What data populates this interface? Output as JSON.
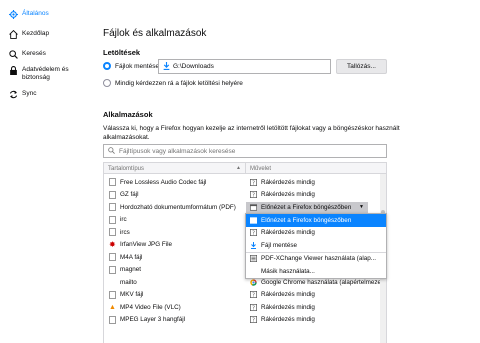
{
  "sidebar": {
    "items": [
      {
        "label": "Általános",
        "icon": "gear-icon",
        "active": true
      },
      {
        "label": "Kezdőlap",
        "icon": "home-icon",
        "active": false
      },
      {
        "label": "Keresés",
        "icon": "search-icon",
        "active": false
      },
      {
        "label_line1": "Adatvédelem és",
        "label_line2": "biztonság",
        "icon": "lock-icon",
        "active": false
      },
      {
        "label": "Sync",
        "icon": "sync-icon",
        "active": false
      }
    ]
  },
  "main": {
    "title": "Fájlok és alkalmazások",
    "downloads": {
      "heading": "Letöltések",
      "save_label": "Fájlok mentése",
      "save_path": "G:\\Downloads",
      "browse_button": "Tallózás...",
      "ask_label": "Mindig kérdezzen rá a fájlok letöltési helyére"
    },
    "apps": {
      "heading": "Alkalmazások",
      "description": "Válassza ki, hogy a Firefox hogyan kezelje az internetről letöltött fájlokat vagy a böngészéskor használt alkalmazásokat.",
      "search_placeholder": "Fájltípusok vagy alkalmazások keresése",
      "columns": [
        "Tartalomtípus",
        "Művelet"
      ],
      "sort_indicator": "▲",
      "rows": [
        {
          "type": "Free Lossless Audio Codec fájl",
          "action": "Rákérdezés mindig"
        },
        {
          "type": "GZ fájl",
          "action": "Rákérdezés mindig"
        },
        {
          "type": "Hordozható dokumentumformátum (PDF)",
          "action": "Előnézet a Firefox böngészőben"
        },
        {
          "type": "irc",
          "action": ""
        },
        {
          "type": "ircs",
          "action": ""
        },
        {
          "type": "IrfanView JPG File",
          "action": ""
        },
        {
          "type": "M4A fájl",
          "action": ""
        },
        {
          "type": "magnet",
          "action": ""
        },
        {
          "type": "mailto",
          "action": "Google Chrome használata (alapértelmezett)"
        },
        {
          "type": "MKV fájl",
          "action": "Rákérdezés mindig"
        },
        {
          "type": "MP4 Video File (VLC)",
          "action": "Rákérdezés mindig"
        },
        {
          "type": "MPEG Layer 3 hangfájl",
          "action": "Rákérdezés mindig"
        }
      ],
      "dropdown_options": [
        {
          "label": "Előnézet a Firefox böngészőben",
          "highlighted": true
        },
        {
          "label": "Rákérdezés mindig",
          "highlighted": false
        },
        {
          "label": "Fájl mentése",
          "highlighted": false
        },
        {
          "label": "PDF-XChange Viewer használata (alap...",
          "highlighted": false
        },
        {
          "label": "Másik használata...",
          "highlighted": false
        }
      ]
    }
  },
  "colors": {
    "accent": "#0a84ff",
    "text": "#0c0c0d",
    "border": "#d7d7db"
  }
}
